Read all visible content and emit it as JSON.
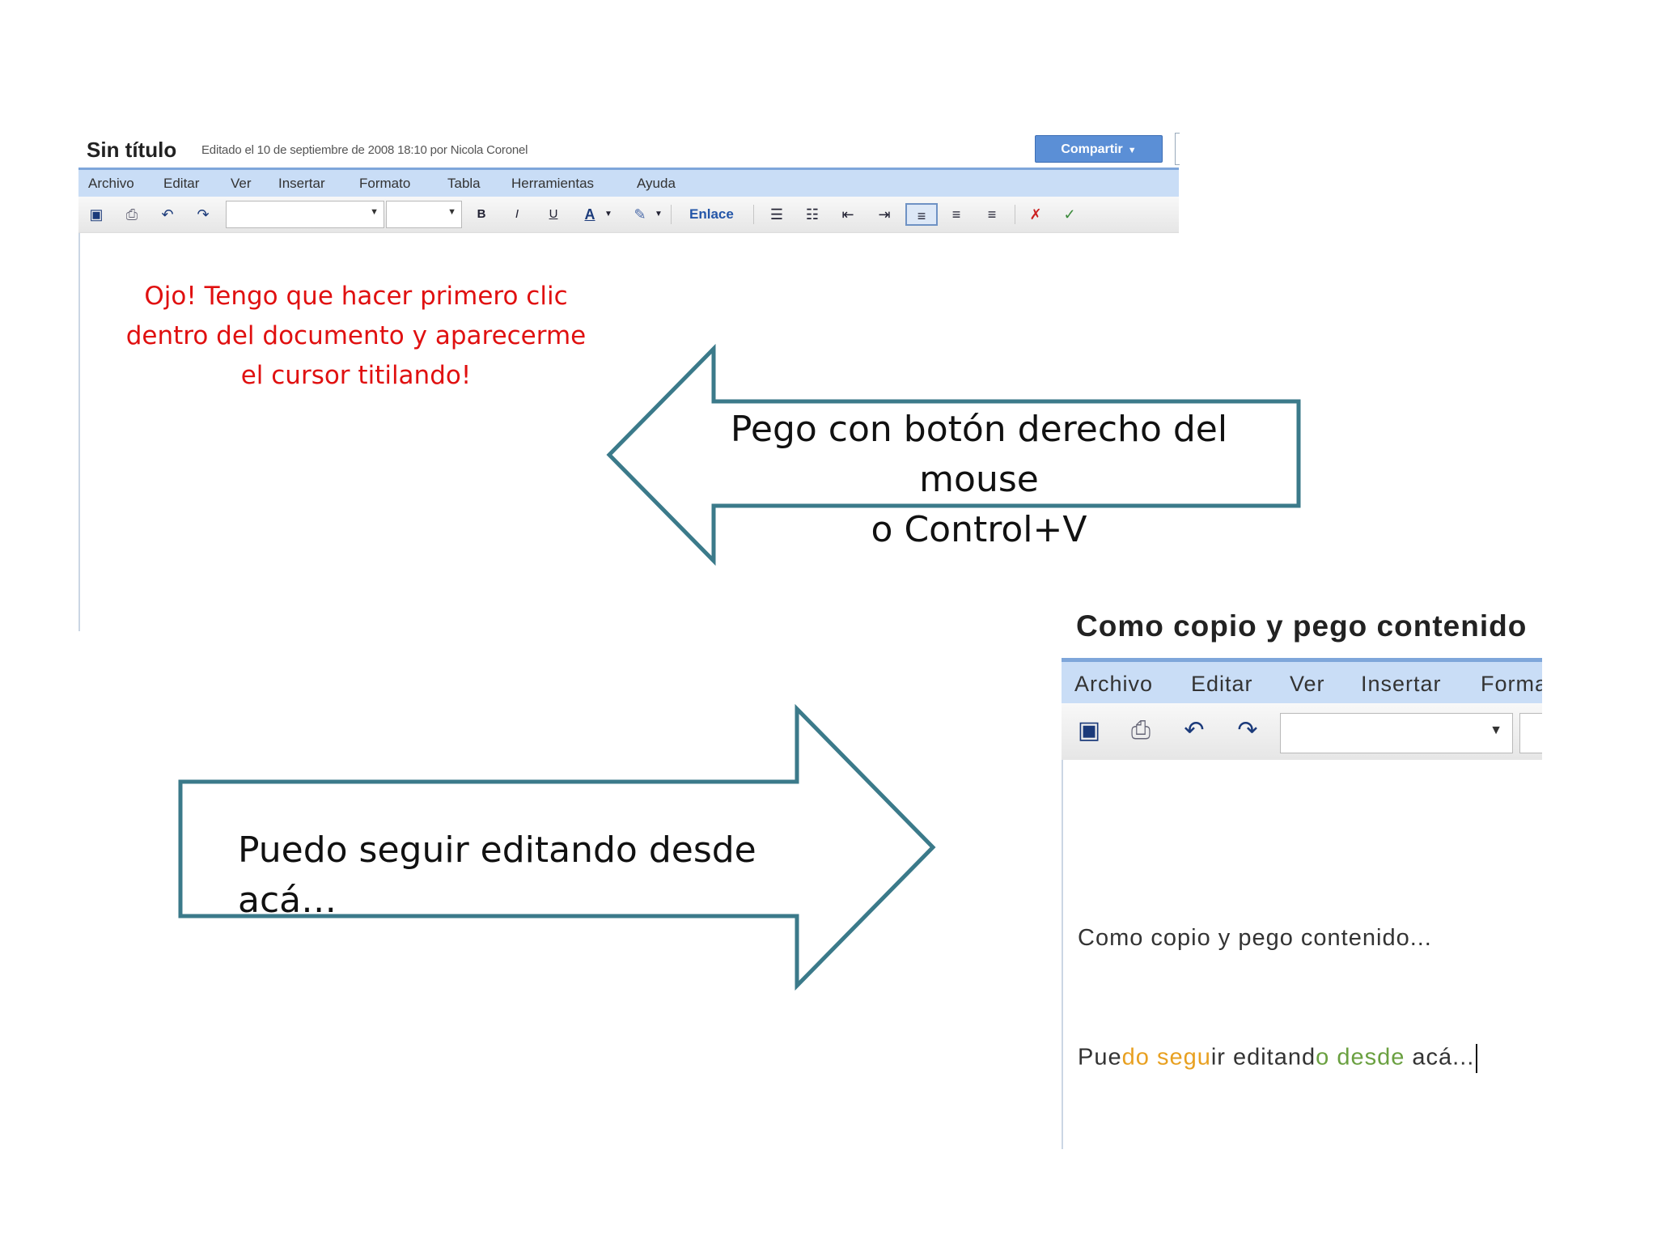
{
  "top_screenshot": {
    "doc_title": "Sin título",
    "doc_meta": "Editado el 10 de septiembre de 2008 18:10 por Nicola Coronel",
    "share_button": "Compartir",
    "menu": [
      "Archivo",
      "Editar",
      "Ver",
      "Insertar",
      "Formato",
      "Tabla",
      "Herramientas",
      "Ayuda"
    ],
    "toolbar": {
      "bold": "B",
      "italic": "I",
      "underline": "U",
      "text_color": "A",
      "link_label": "Enlace"
    }
  },
  "note": {
    "lines": [
      "Ojo! Tengo que hacer primero clic",
      "dentro del documento y aparecerme",
      "el cursor titilando!"
    ],
    "color": "#e01010"
  },
  "arrow_left": {
    "lines": [
      "Pego con botón derecho del mouse",
      "o Control+V"
    ],
    "stroke": "#3b7a8a"
  },
  "arrow_right": {
    "text": "Puedo seguir editando desde acá…",
    "stroke": "#3b7a8a"
  },
  "bottom_screenshot": {
    "doc_title": "Como copio y pego contenido",
    "menu": [
      "Archivo",
      "Editar",
      "Ver",
      "Insertar",
      "Forma"
    ],
    "line1": "Como copio y pego contenido...",
    "line2_parts": [
      "Pue",
      "do ",
      "segu",
      "ir edita",
      "nd",
      "o desde",
      " acá..."
    ]
  }
}
